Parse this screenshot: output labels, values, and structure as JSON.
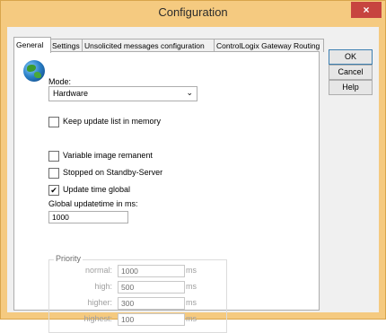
{
  "window": {
    "title": "Configuration",
    "close_glyph": "×"
  },
  "tabs": [
    {
      "label": "General",
      "active": true
    },
    {
      "label": "Settings",
      "active": false
    },
    {
      "label": "Unsolicited messages configuration",
      "active": false
    },
    {
      "label": "ControlLogix Gateway Routing",
      "active": false
    }
  ],
  "general": {
    "icon": "globe-icon",
    "mode_label": "Mode:",
    "mode_value": "Hardware",
    "checkboxes": [
      {
        "label": "Keep update list in memory",
        "checked": false
      },
      {
        "label": "Variable image remanent",
        "checked": false
      },
      {
        "label": "Stopped on Standby-Server",
        "checked": false
      },
      {
        "label": "Update time global",
        "checked": true
      }
    ],
    "updatetime_label": "Global updatetime in ms:",
    "updatetime_value": "1000",
    "priority": {
      "title": "Priority",
      "rows": [
        {
          "label": "normal:",
          "value": "1000",
          "unit": "ms"
        },
        {
          "label": "high:",
          "value": "500",
          "unit": "ms"
        },
        {
          "label": "higher:",
          "value": "300",
          "unit": "ms"
        },
        {
          "label": "highest:",
          "value": "100",
          "unit": "ms"
        }
      ]
    }
  },
  "buttons": {
    "ok": "OK",
    "cancel": "Cancel",
    "help": "Help"
  },
  "colors": {
    "title_bar": "#f5ca80",
    "close_button": "#c7443f"
  }
}
